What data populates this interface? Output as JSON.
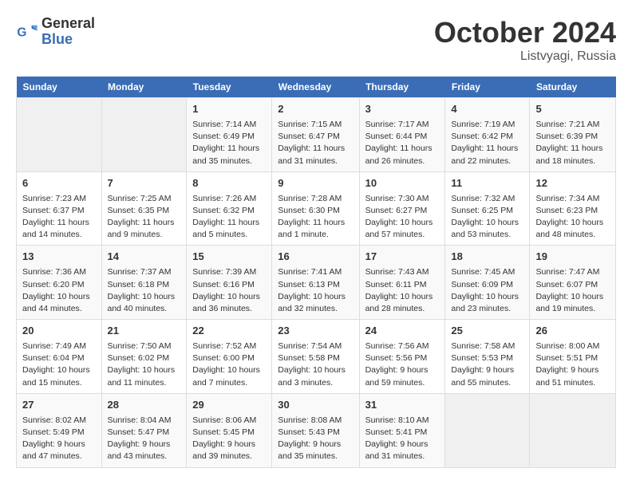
{
  "logo": {
    "line1": "General",
    "line2": "Blue"
  },
  "title": "October 2024",
  "subtitle": "Listvyagi, Russia",
  "days_header": [
    "Sunday",
    "Monday",
    "Tuesday",
    "Wednesday",
    "Thursday",
    "Friday",
    "Saturday"
  ],
  "weeks": [
    [
      {
        "day": "",
        "info": ""
      },
      {
        "day": "",
        "info": ""
      },
      {
        "day": "1",
        "info": "Sunrise: 7:14 AM\nSunset: 6:49 PM\nDaylight: 11 hours and 35 minutes."
      },
      {
        "day": "2",
        "info": "Sunrise: 7:15 AM\nSunset: 6:47 PM\nDaylight: 11 hours and 31 minutes."
      },
      {
        "day": "3",
        "info": "Sunrise: 7:17 AM\nSunset: 6:44 PM\nDaylight: 11 hours and 26 minutes."
      },
      {
        "day": "4",
        "info": "Sunrise: 7:19 AM\nSunset: 6:42 PM\nDaylight: 11 hours and 22 minutes."
      },
      {
        "day": "5",
        "info": "Sunrise: 7:21 AM\nSunset: 6:39 PM\nDaylight: 11 hours and 18 minutes."
      }
    ],
    [
      {
        "day": "6",
        "info": "Sunrise: 7:23 AM\nSunset: 6:37 PM\nDaylight: 11 hours and 14 minutes."
      },
      {
        "day": "7",
        "info": "Sunrise: 7:25 AM\nSunset: 6:35 PM\nDaylight: 11 hours and 9 minutes."
      },
      {
        "day": "8",
        "info": "Sunrise: 7:26 AM\nSunset: 6:32 PM\nDaylight: 11 hours and 5 minutes."
      },
      {
        "day": "9",
        "info": "Sunrise: 7:28 AM\nSunset: 6:30 PM\nDaylight: 11 hours and 1 minute."
      },
      {
        "day": "10",
        "info": "Sunrise: 7:30 AM\nSunset: 6:27 PM\nDaylight: 10 hours and 57 minutes."
      },
      {
        "day": "11",
        "info": "Sunrise: 7:32 AM\nSunset: 6:25 PM\nDaylight: 10 hours and 53 minutes."
      },
      {
        "day": "12",
        "info": "Sunrise: 7:34 AM\nSunset: 6:23 PM\nDaylight: 10 hours and 48 minutes."
      }
    ],
    [
      {
        "day": "13",
        "info": "Sunrise: 7:36 AM\nSunset: 6:20 PM\nDaylight: 10 hours and 44 minutes."
      },
      {
        "day": "14",
        "info": "Sunrise: 7:37 AM\nSunset: 6:18 PM\nDaylight: 10 hours and 40 minutes."
      },
      {
        "day": "15",
        "info": "Sunrise: 7:39 AM\nSunset: 6:16 PM\nDaylight: 10 hours and 36 minutes."
      },
      {
        "day": "16",
        "info": "Sunrise: 7:41 AM\nSunset: 6:13 PM\nDaylight: 10 hours and 32 minutes."
      },
      {
        "day": "17",
        "info": "Sunrise: 7:43 AM\nSunset: 6:11 PM\nDaylight: 10 hours and 28 minutes."
      },
      {
        "day": "18",
        "info": "Sunrise: 7:45 AM\nSunset: 6:09 PM\nDaylight: 10 hours and 23 minutes."
      },
      {
        "day": "19",
        "info": "Sunrise: 7:47 AM\nSunset: 6:07 PM\nDaylight: 10 hours and 19 minutes."
      }
    ],
    [
      {
        "day": "20",
        "info": "Sunrise: 7:49 AM\nSunset: 6:04 PM\nDaylight: 10 hours and 15 minutes."
      },
      {
        "day": "21",
        "info": "Sunrise: 7:50 AM\nSunset: 6:02 PM\nDaylight: 10 hours and 11 minutes."
      },
      {
        "day": "22",
        "info": "Sunrise: 7:52 AM\nSunset: 6:00 PM\nDaylight: 10 hours and 7 minutes."
      },
      {
        "day": "23",
        "info": "Sunrise: 7:54 AM\nSunset: 5:58 PM\nDaylight: 10 hours and 3 minutes."
      },
      {
        "day": "24",
        "info": "Sunrise: 7:56 AM\nSunset: 5:56 PM\nDaylight: 9 hours and 59 minutes."
      },
      {
        "day": "25",
        "info": "Sunrise: 7:58 AM\nSunset: 5:53 PM\nDaylight: 9 hours and 55 minutes."
      },
      {
        "day": "26",
        "info": "Sunrise: 8:00 AM\nSunset: 5:51 PM\nDaylight: 9 hours and 51 minutes."
      }
    ],
    [
      {
        "day": "27",
        "info": "Sunrise: 8:02 AM\nSunset: 5:49 PM\nDaylight: 9 hours and 47 minutes."
      },
      {
        "day": "28",
        "info": "Sunrise: 8:04 AM\nSunset: 5:47 PM\nDaylight: 9 hours and 43 minutes."
      },
      {
        "day": "29",
        "info": "Sunrise: 8:06 AM\nSunset: 5:45 PM\nDaylight: 9 hours and 39 minutes."
      },
      {
        "day": "30",
        "info": "Sunrise: 8:08 AM\nSunset: 5:43 PM\nDaylight: 9 hours and 35 minutes."
      },
      {
        "day": "31",
        "info": "Sunrise: 8:10 AM\nSunset: 5:41 PM\nDaylight: 9 hours and 31 minutes."
      },
      {
        "day": "",
        "info": ""
      },
      {
        "day": "",
        "info": ""
      }
    ]
  ]
}
